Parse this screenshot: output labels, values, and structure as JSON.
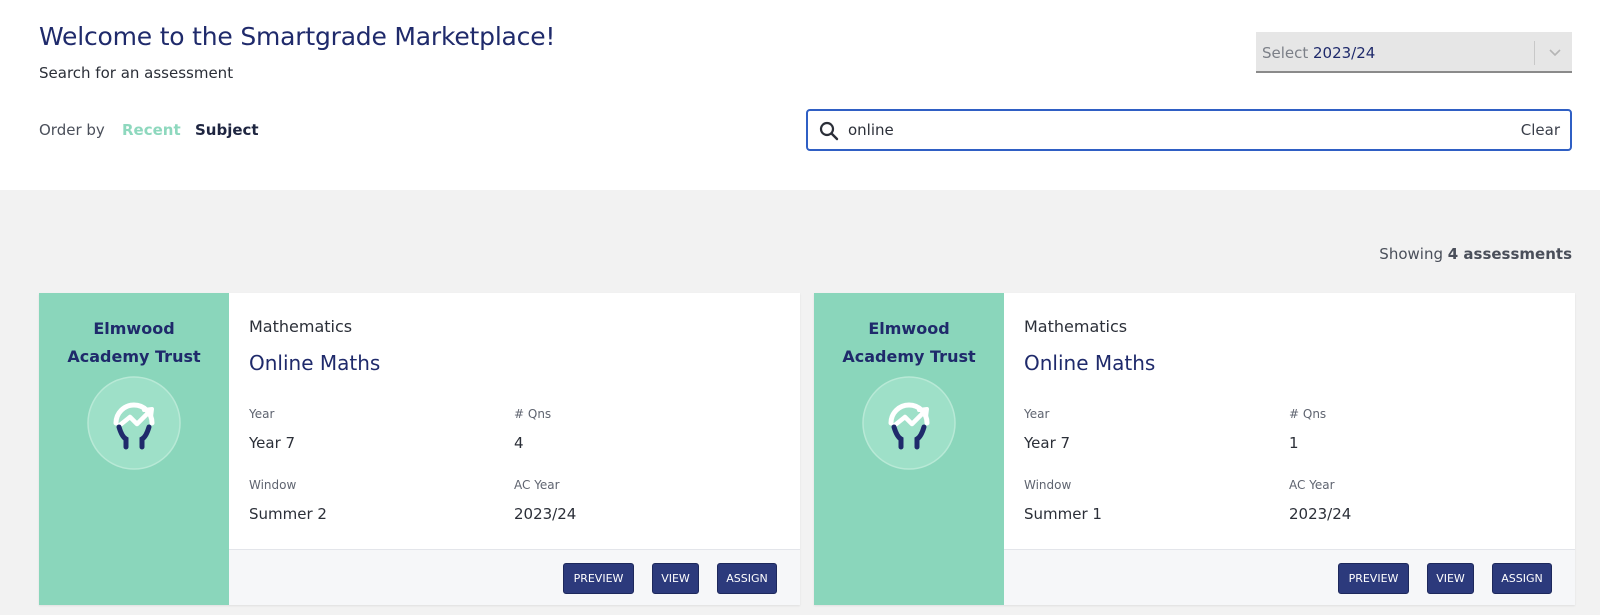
{
  "header": {
    "title": "Welcome to the Smartgrade Marketplace!",
    "subtitle": "Search for an assessment"
  },
  "order": {
    "label": "Order by",
    "options": [
      {
        "label": "Recent",
        "active": true
      },
      {
        "label": "Subject",
        "active": false
      }
    ]
  },
  "year_select": {
    "label": "Select",
    "value": "2023/24",
    "icon": "chevron-down-icon"
  },
  "search": {
    "value": "online",
    "clear_label": "Clear",
    "icon": "search-icon"
  },
  "results": {
    "prefix": "Showing",
    "count_text": "4 assessments"
  },
  "colors": {
    "accent_green": "#8ad6bb",
    "navy": "#1f2a6b",
    "button": "#2c3a7c",
    "search_border": "#2f5fc4"
  },
  "field_labels": {
    "year": "Year",
    "qns": "# Qns",
    "window": "Window",
    "ac_year": "AC Year"
  },
  "buttons": {
    "preview": "PREVIEW",
    "view": "VIEW",
    "assign": "ASSIGN"
  },
  "cards": [
    {
      "org_line1": "Elmwood",
      "org_line2": "Academy Trust",
      "subject": "Mathematics",
      "name": "Online Maths",
      "year": "Year 7",
      "qns": "4",
      "window": "Summer 2",
      "ac_year": "2023/24"
    },
    {
      "org_line1": "Elmwood",
      "org_line2": "Academy Trust",
      "subject": "Mathematics",
      "name": "Online Maths",
      "year": "Year 7",
      "qns": "1",
      "window": "Summer 1",
      "ac_year": "2023/24"
    }
  ]
}
